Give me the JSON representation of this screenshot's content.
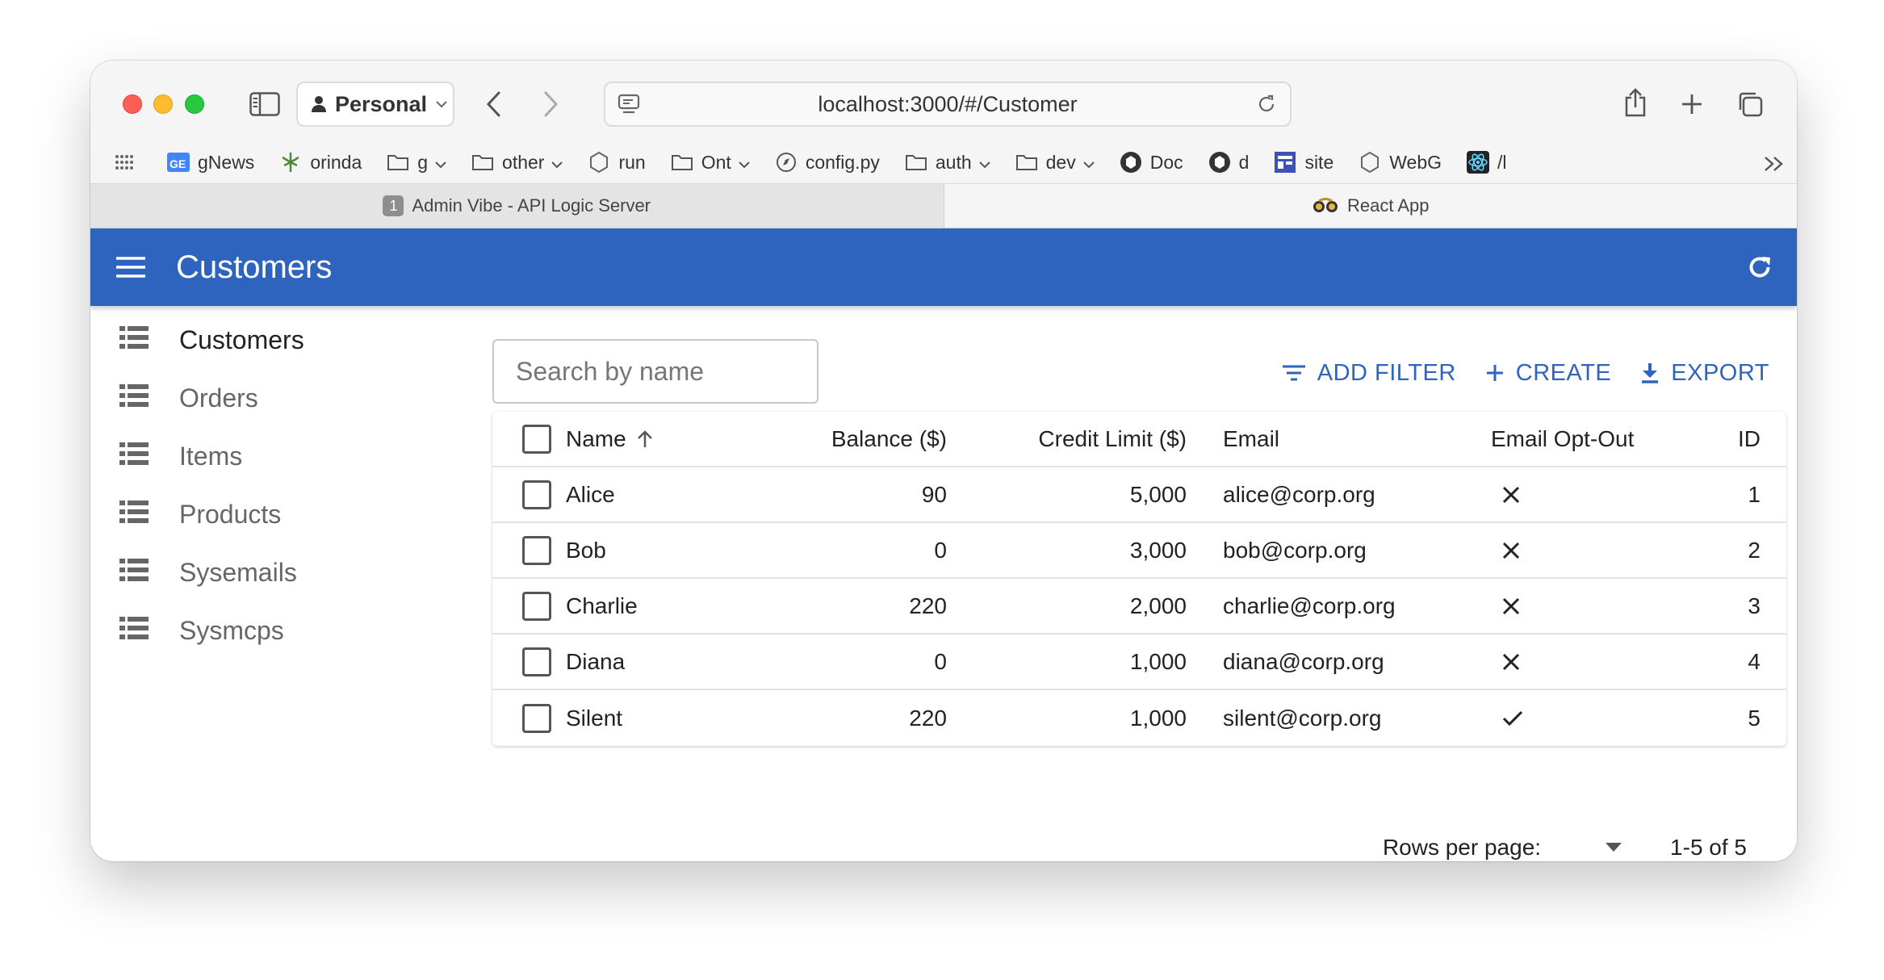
{
  "browser": {
    "profile": "Personal",
    "url": "localhost:3000/#/Customer",
    "bookmarks": [
      {
        "label": "gNews",
        "icon": "gnews-icon"
      },
      {
        "label": "orinda",
        "icon": "leaf-icon"
      },
      {
        "label": "g",
        "icon": "folder-icon",
        "dropdown": true
      },
      {
        "label": "other",
        "icon": "folder-icon",
        "dropdown": true
      },
      {
        "label": "run",
        "icon": "hexagon-icon"
      },
      {
        "label": "Ont",
        "icon": "folder-icon",
        "dropdown": true
      },
      {
        "label": "config.py",
        "icon": "compass-icon"
      },
      {
        "label": "auth",
        "icon": "folder-icon",
        "dropdown": true
      },
      {
        "label": "dev",
        "icon": "folder-icon",
        "dropdown": true
      },
      {
        "label": "Doc",
        "icon": "doc-icon"
      },
      {
        "label": "d",
        "icon": "doc-icon"
      },
      {
        "label": "site",
        "icon": "site-icon"
      },
      {
        "label": "WebG",
        "icon": "hexagon-icon"
      },
      {
        "label": "/l",
        "icon": "react-icon"
      }
    ],
    "tabs": [
      {
        "label": "Admin Vibe - API Logic Server",
        "badge": "1",
        "active": false
      },
      {
        "label": "React App",
        "active": true
      }
    ]
  },
  "app": {
    "title": "Customers",
    "accent": "#2e63be"
  },
  "sidebar": {
    "items": [
      {
        "label": "Customers"
      },
      {
        "label": "Orders"
      },
      {
        "label": "Items"
      },
      {
        "label": "Products"
      },
      {
        "label": "Sysemails"
      },
      {
        "label": "Sysmcps"
      }
    ]
  },
  "toolbar": {
    "search_placeholder": "Search by name",
    "add_filter": "ADD FILTER",
    "create": "CREATE",
    "export": "EXPORT"
  },
  "table": {
    "columns": [
      "Name",
      "Balance ($)",
      "Credit Limit ($)",
      "Email",
      "Email Opt-Out",
      "ID"
    ],
    "sort": {
      "column": "Name",
      "direction": "asc"
    },
    "rows": [
      {
        "name": "Alice",
        "balance": "90",
        "credit_limit": "5,000",
        "email": "alice@corp.org",
        "opt_out": false,
        "id": "1"
      },
      {
        "name": "Bob",
        "balance": "0",
        "credit_limit": "3,000",
        "email": "bob@corp.org",
        "opt_out": false,
        "id": "2"
      },
      {
        "name": "Charlie",
        "balance": "220",
        "credit_limit": "2,000",
        "email": "charlie@corp.org",
        "opt_out": false,
        "id": "3"
      },
      {
        "name": "Diana",
        "balance": "0",
        "credit_limit": "1,000",
        "email": "diana@corp.org",
        "opt_out": false,
        "id": "4"
      },
      {
        "name": "Silent",
        "balance": "220",
        "credit_limit": "1,000",
        "email": "silent@corp.org",
        "opt_out": true,
        "id": "5"
      }
    ]
  },
  "pagination": {
    "rows_per_page_label": "Rows per page:",
    "range": "1-5 of 5"
  }
}
